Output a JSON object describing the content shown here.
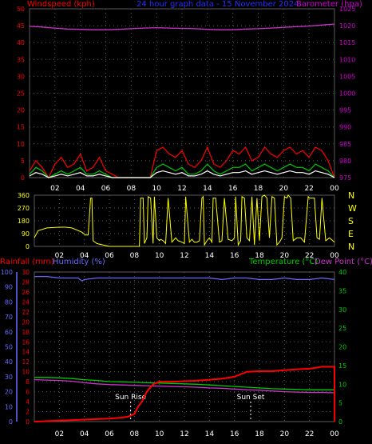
{
  "header": {
    "title": "24 hour graph data - 15 November 2024",
    "left_label": "Windspeed (kph)",
    "right_label": "Barometer (hpa)"
  },
  "colors": {
    "background": "#000000",
    "grid": "#5a5a5a",
    "wind_axis": "#ff0000",
    "baro_axis": "#d200d2",
    "title": "#2a2aff",
    "wind_speed": "#ff0000",
    "wind_gust": "#00c800",
    "wind_avg": "#ffffff",
    "barometer": "#cc33cc",
    "direction": "#ffff00",
    "compass": "#ffff00",
    "rain": "#ff0000",
    "humidity": "#6a6aff",
    "temperature": "#00cc00",
    "dewpoint": "#cc33cc",
    "sun_marker": "#ffffff",
    "hour_labels": "#ffffff"
  },
  "panel3": {
    "rain_label": "Rainfall (mm)",
    "humidity_label": "Humidity (%)",
    "temp_label": "Temperature (°C)",
    "dew_label": "Dew Point (°C)"
  },
  "compass_labels": [
    "N",
    "W",
    "S",
    "E",
    "N"
  ],
  "hour_labels": [
    "02",
    "04",
    "06",
    "08",
    "10",
    "12",
    "14",
    "16",
    "18",
    "20",
    "22",
    "00"
  ],
  "sun_rise": {
    "label": "Sun Rise"
  },
  "sun_set": {
    "label": "Sun Set"
  },
  "chart_data": [
    {
      "type": "line",
      "title": "24 hour graph data - 15 November 2024",
      "xlabel": "",
      "x_ticks": [
        "02",
        "04",
        "06",
        "08",
        "10",
        "12",
        "14",
        "16",
        "18",
        "20",
        "22",
        "00"
      ],
      "xlim": [
        0,
        24
      ],
      "ylabel": "Windspeed (kph)",
      "ylim": [
        0,
        50
      ],
      "y_ticks": [
        0,
        5,
        10,
        15,
        20,
        25,
        30,
        35,
        40,
        45,
        50
      ],
      "y2label": "Barometer (hpa)",
      "y2lim": [
        975,
        1025
      ],
      "y2_ticks": [
        975,
        980,
        985,
        990,
        995,
        1000,
        1005,
        1010,
        1015,
        1020,
        1025
      ],
      "series": [
        {
          "axis": "y2",
          "x": [
            0,
            1,
            2,
            3,
            4,
            5,
            6,
            7,
            8,
            9,
            10,
            11,
            12,
            13,
            14,
            15,
            16,
            17,
            18,
            19,
            20,
            21,
            22,
            23,
            24
          ],
          "values": [
            1019.8,
            1019.6,
            1019.3,
            1019.0,
            1018.9,
            1018.8,
            1018.8,
            1018.9,
            1019.1,
            1019.3,
            1019.4,
            1019.3,
            1019.2,
            1019.1,
            1018.9,
            1018.8,
            1018.8,
            1019.0,
            1019.1,
            1019.3,
            1019.5,
            1019.7,
            1019.9,
            1020.2,
            1020.5
          ]
        },
        {
          "axis": "y",
          "x": [
            0,
            0.5,
            1,
            1.5,
            2,
            2.5,
            3,
            3.5,
            4,
            4.5,
            5,
            5.5,
            6,
            6.5,
            7,
            7.5,
            8,
            8.5,
            9,
            9.5,
            10,
            10.5,
            11,
            11.5,
            12,
            12.5,
            13,
            13.5,
            14,
            14.5,
            15,
            15.5,
            16,
            16.5,
            17,
            17.5,
            18,
            18.5,
            19,
            19.5,
            20,
            20.5,
            21,
            21.5,
            22,
            22.5,
            23,
            23.5,
            24
          ],
          "values": [
            2,
            5,
            3,
            0,
            4,
            6,
            3,
            4,
            7,
            2,
            3,
            6,
            2,
            1,
            0,
            0,
            0,
            0,
            0,
            0,
            8,
            9,
            7,
            6,
            8,
            4,
            3,
            5,
            9,
            4,
            3,
            5,
            8,
            7,
            9,
            5,
            6,
            9,
            7,
            6,
            8,
            9,
            7,
            8,
            6,
            9,
            8,
            5,
            0
          ]
        },
        {
          "axis": "y",
          "x": [
            0,
            0.5,
            1,
            1.5,
            2,
            2.5,
            3,
            3.5,
            4,
            4.5,
            5,
            5.5,
            6,
            6.5,
            7,
            7.5,
            8,
            8.5,
            9,
            9.5,
            10,
            10.5,
            11,
            11.5,
            12,
            12.5,
            13,
            13.5,
            14,
            14.5,
            15,
            15.5,
            16,
            16.5,
            17,
            17.5,
            18,
            18.5,
            19,
            19.5,
            20,
            20.5,
            21,
            21.5,
            22,
            22.5,
            23,
            23.5,
            24
          ],
          "values": [
            1,
            3,
            2,
            0,
            1,
            2,
            1,
            2,
            3,
            1,
            1,
            2,
            1,
            0,
            0,
            0,
            0,
            0,
            0,
            0,
            3,
            4,
            3,
            2,
            3,
            1,
            1,
            2,
            4,
            2,
            1,
            2,
            3,
            3,
            4,
            2,
            3,
            4,
            3,
            2,
            3,
            4,
            3,
            3,
            2,
            4,
            3,
            2,
            0
          ]
        },
        {
          "axis": "y",
          "x": [
            0,
            0.5,
            1,
            1.5,
            2,
            2.5,
            3,
            3.5,
            4,
            4.5,
            5,
            5.5,
            6,
            6.5,
            7,
            7.5,
            8,
            8.5,
            9,
            9.5,
            10,
            10.5,
            11,
            11.5,
            12,
            12.5,
            13,
            13.5,
            14,
            14.5,
            15,
            15.5,
            16,
            16.5,
            17,
            17.5,
            18,
            18.5,
            19,
            19.5,
            20,
            20.5,
            21,
            21.5,
            22,
            22.5,
            23,
            23.5,
            24
          ],
          "values": [
            0.5,
            1.5,
            1,
            0,
            0.5,
            1,
            0.5,
            1,
            1.5,
            0.5,
            0.5,
            1,
            0.5,
            0,
            0,
            0,
            0,
            0,
            0,
            0,
            1.5,
            2,
            1.5,
            1,
            1.5,
            0.5,
            0.5,
            1,
            2,
            1,
            0.5,
            1,
            1.5,
            1.5,
            2,
            1,
            1.5,
            2,
            1.5,
            1,
            1.5,
            2,
            1.5,
            1.5,
            1,
            2,
            1.5,
            1,
            0
          ]
        }
      ]
    },
    {
      "type": "line",
      "ylim": [
        0,
        360
      ],
      "y_ticks": [
        0,
        90,
        180,
        270,
        360
      ],
      "xlim": [
        0,
        24
      ],
      "series": [
        {
          "x": [
            0,
            0.3,
            1,
            2,
            2.5,
            3,
            3.8,
            4.1,
            4.3,
            4.5,
            4.6,
            4.7,
            5.0,
            6.0,
            7.0,
            8.0,
            8.4,
            8.5,
            8.7,
            8.8,
            9.0,
            9.1,
            9.3,
            9.5,
            9.6,
            9.8,
            10.0,
            10.1,
            10.3,
            10.5,
            10.7,
            11.0,
            11.3,
            11.5,
            11.8,
            12.0,
            12.1,
            12.4,
            12.6,
            12.8,
            13.0,
            13.2,
            13.4,
            13.5,
            13.6,
            13.8,
            14.0,
            14.2,
            14.3,
            14.5,
            14.8,
            15.0,
            15.2,
            15.5,
            15.8,
            16.0,
            16.1,
            16.3,
            16.5,
            16.6,
            16.8,
            17.0,
            17.2,
            17.4,
            17.6,
            17.8,
            18.0,
            18.2,
            18.4,
            18.6,
            18.8,
            19.0,
            19.2,
            19.4,
            19.6,
            19.8,
            20.0,
            20.2,
            20.3,
            20.5,
            20.7,
            21.0,
            21.3,
            21.6,
            21.9,
            22.0,
            22.2,
            22.4,
            22.6,
            22.8,
            23.0,
            23.3,
            23.6,
            24.0
          ],
          "values": [
            60,
            110,
            130,
            135,
            135,
            130,
            100,
            80,
            80,
            340,
            340,
            40,
            20,
            0,
            0,
            0,
            0,
            340,
            340,
            20,
            60,
            350,
            340,
            20,
            350,
            60,
            40,
            50,
            40,
            20,
            340,
            30,
            60,
            40,
            30,
            20,
            350,
            30,
            50,
            30,
            30,
            40,
            340,
            350,
            10,
            40,
            60,
            30,
            340,
            340,
            30,
            40,
            340,
            50,
            40,
            60,
            350,
            10,
            40,
            350,
            340,
            60,
            40,
            350,
            10,
            340,
            40,
            350,
            360,
            340,
            60,
            350,
            340,
            10,
            30,
            60,
            350,
            340,
            360,
            340,
            40,
            60,
            60,
            30,
            350,
            340,
            340,
            340,
            60,
            50,
            340,
            40,
            60,
            30
          ]
        }
      ]
    },
    {
      "type": "line",
      "xlim": [
        0,
        24
      ],
      "ylabel": "Rainfall (mm)",
      "ylim": [
        0,
        30
      ],
      "y_ticks": [
        0,
        2,
        4,
        6,
        8,
        10,
        12,
        14,
        16,
        18,
        20,
        22,
        24,
        26,
        28,
        30
      ],
      "y_left2label": "Humidity (%)",
      "y_left2lim": [
        0,
        100
      ],
      "y_left2_ticks": [
        0,
        10,
        20,
        30,
        40,
        50,
        60,
        70,
        80,
        90,
        100
      ],
      "y2label": "Temperature (°C)",
      "y2lim": [
        0,
        40
      ],
      "y2_ticks": [
        0,
        5,
        10,
        15,
        20,
        25,
        30,
        35,
        40
      ],
      "y2label_2": "Dew Point (°C)",
      "sun_rise_x": 7.7,
      "sun_set_x": 17.3,
      "series": [
        {
          "name": "Rainfall (mm)",
          "axis": "rain",
          "x": [
            0,
            2,
            3,
            4,
            5,
            6,
            7,
            7.5,
            8,
            8.3,
            8.6,
            9,
            9.5,
            10,
            11,
            12,
            13,
            14,
            15,
            16,
            17,
            18,
            19,
            20,
            21,
            22,
            22.5,
            23,
            23.8,
            24,
            24.01
          ],
          "values": [
            0,
            0.2,
            0.3,
            0.4,
            0.5,
            0.6,
            0.8,
            1.0,
            1.5,
            3,
            4,
            6,
            7.5,
            8,
            8,
            8.1,
            8.2,
            8.4,
            8.6,
            9,
            10,
            10.1,
            10.1,
            10.3,
            10.5,
            10.6,
            10.8,
            11,
            11,
            11,
            0
          ]
        },
        {
          "name": "Humidity (%)",
          "axis": "humidity",
          "x": [
            0,
            1,
            2,
            3,
            3.5,
            3.8,
            4,
            5,
            6,
            7,
            8,
            9,
            10,
            11,
            12,
            13,
            14,
            15,
            16,
            17,
            18,
            19,
            20,
            21,
            22,
            23,
            24
          ],
          "values": [
            97,
            97,
            96,
            96,
            96,
            94,
            95,
            96,
            96,
            96,
            96,
            96,
            96,
            96,
            96,
            96,
            96,
            95,
            96,
            96,
            95,
            95,
            96,
            95,
            95,
            96,
            95
          ]
        },
        {
          "name": "Temperature (°C)",
          "axis": "temp",
          "x": [
            0,
            1,
            2,
            3,
            4,
            5,
            6,
            7,
            8,
            9,
            10,
            11,
            12,
            13,
            14,
            15,
            16,
            17,
            18,
            19,
            20,
            21,
            22,
            23,
            24
          ],
          "values": [
            11.8,
            11.8,
            11.7,
            11.5,
            11.2,
            11,
            10.7,
            10.6,
            10.5,
            10.4,
            10.3,
            10.2,
            10.1,
            10.0,
            9.8,
            9.6,
            9.4,
            9.2,
            9.0,
            8.8,
            8.7,
            8.6,
            8.5,
            8.5,
            8.5
          ]
        },
        {
          "name": "Dew Point (°C)",
          "axis": "temp",
          "x": [
            0,
            1,
            2,
            3,
            4,
            5,
            6,
            7,
            8,
            9,
            10,
            11,
            12,
            13,
            14,
            15,
            16,
            17,
            18,
            19,
            20,
            21,
            22,
            23,
            24
          ],
          "values": [
            11.2,
            11.1,
            11.0,
            10.8,
            10.4,
            10.1,
            9.9,
            9.8,
            9.7,
            9.6,
            9.5,
            9.4,
            9.3,
            9.2,
            9.0,
            8.9,
            8.7,
            8.5,
            8.4,
            8.2,
            8.0,
            7.9,
            7.8,
            7.8,
            7.7
          ]
        }
      ]
    }
  ]
}
